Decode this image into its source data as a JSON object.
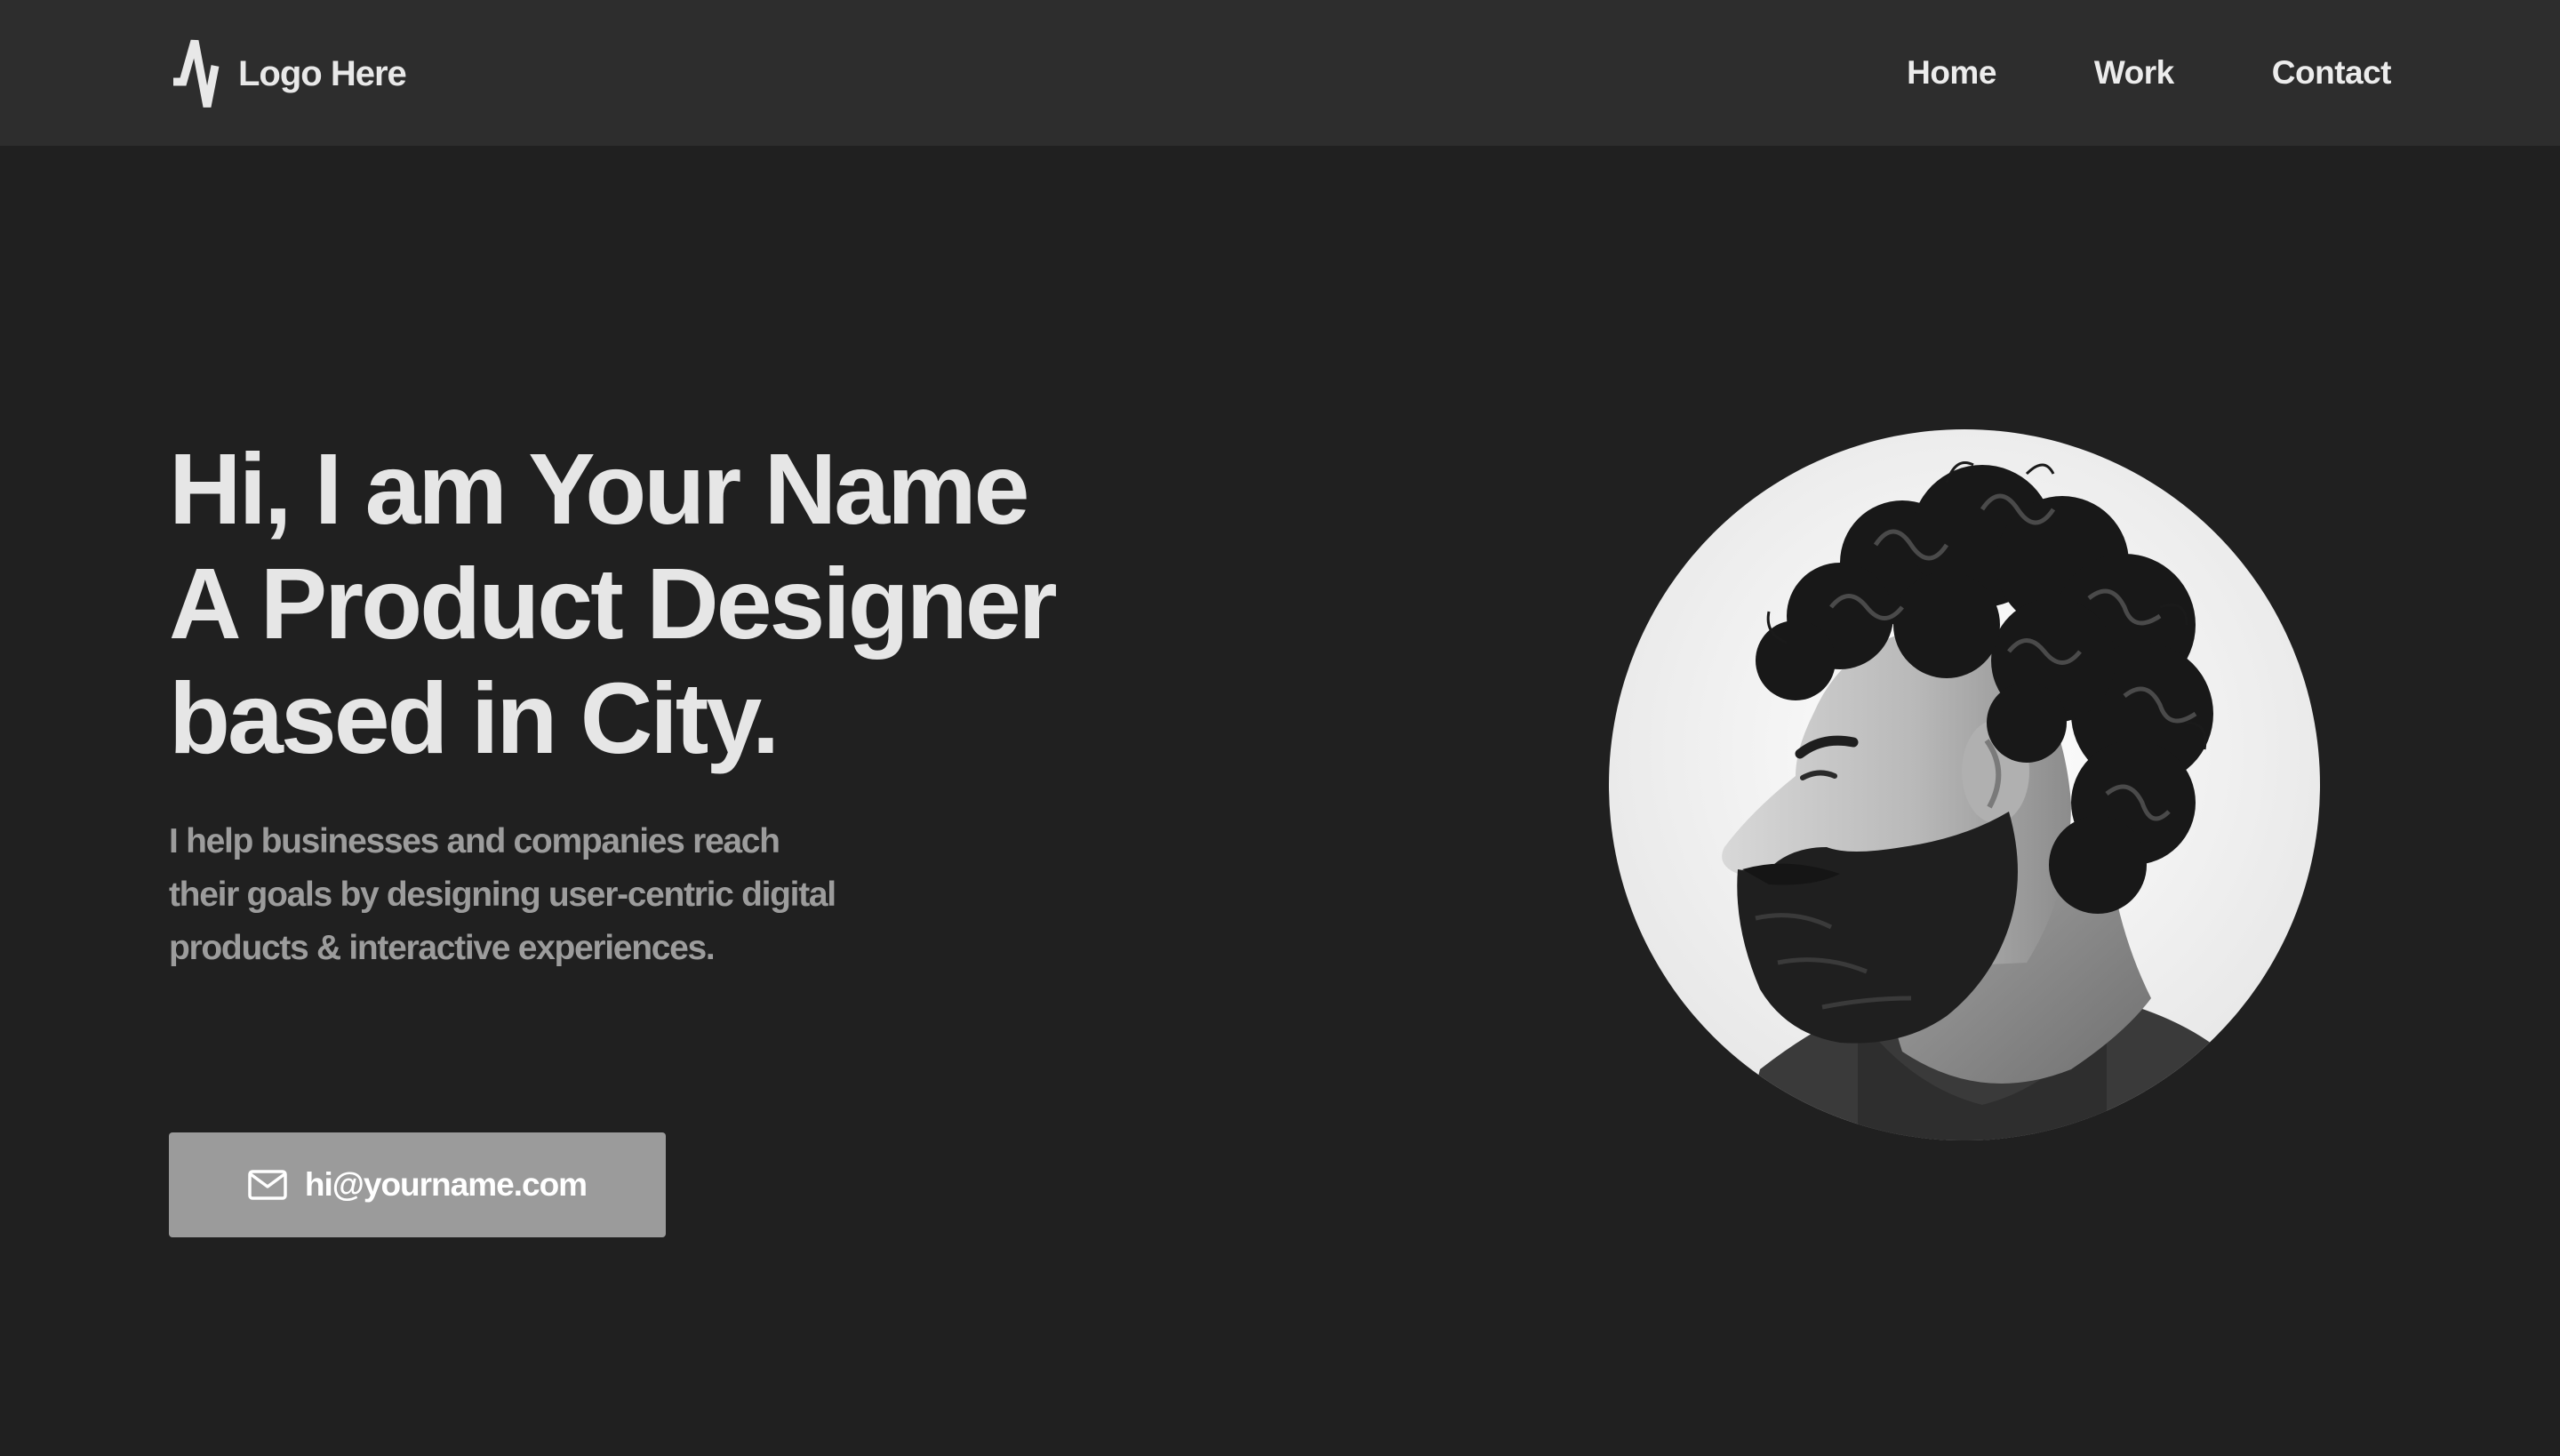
{
  "header": {
    "logo": {
      "icon": "zigzag-logo-icon",
      "text": "Logo Here"
    },
    "nav": [
      {
        "label": "Home"
      },
      {
        "label": "Work"
      },
      {
        "label": "Contact"
      }
    ]
  },
  "hero": {
    "heading_lines": [
      "Hi, I am Your Name",
      "A Product Designer",
      "based in City."
    ],
    "description_lines": [
      "I help businesses and companies reach",
      "their goals by designing user-centric digital",
      "products & interactive experiences."
    ],
    "email_button": {
      "icon": "mail-icon",
      "label": "hi@yourname.com"
    },
    "portrait": {
      "subject": "black-and-white profile photo of a man with curly hair and a beard"
    }
  },
  "colors": {
    "background": "#202020",
    "navbar": "#2d2d2d",
    "heading_text": "#e6e6e6",
    "body_text": "#9c9c9c",
    "button_bg": "#9b9b9b",
    "button_text": "#ffffff"
  }
}
